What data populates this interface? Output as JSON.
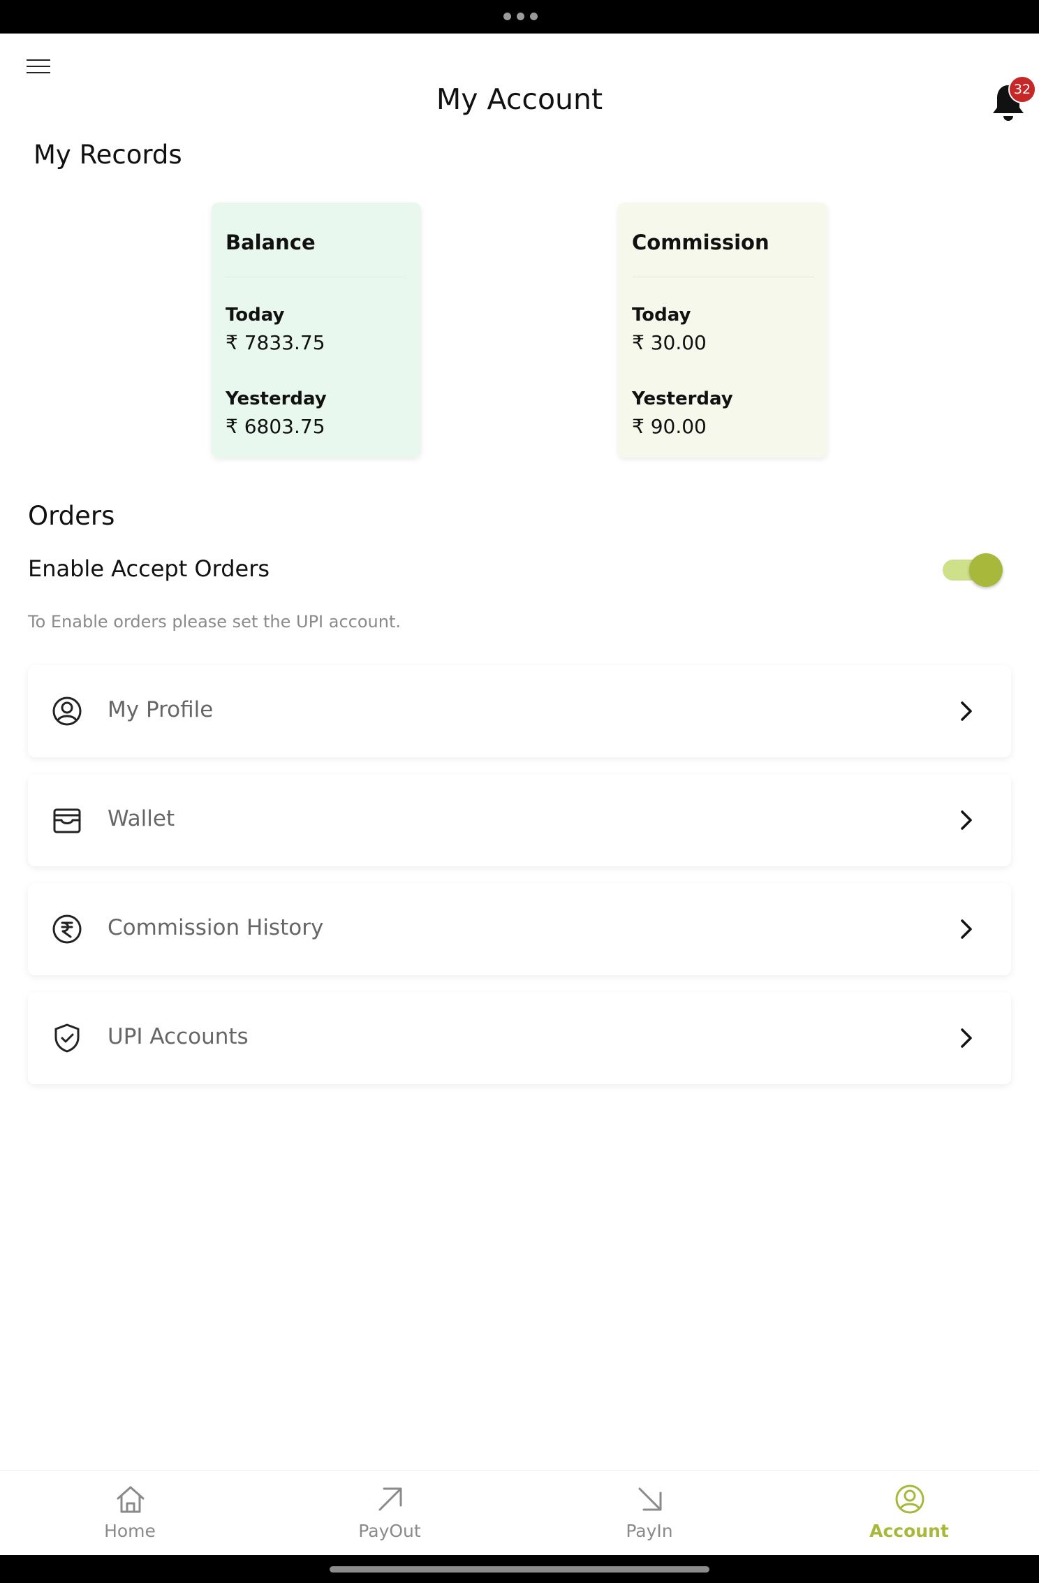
{
  "header": {
    "title": "My Account",
    "notification_count": "32"
  },
  "records": {
    "title": "My Records",
    "balance": {
      "title": "Balance",
      "today_label": "Today",
      "today_value": "₹ 7833.75",
      "yesterday_label": "Yesterday",
      "yesterday_value": "₹ 6803.75"
    },
    "commission": {
      "title": "Commission",
      "today_label": "Today",
      "today_value": "₹ 30.00",
      "yesterday_label": "Yesterday",
      "yesterday_value": "₹ 90.00"
    }
  },
  "orders": {
    "title": "Orders",
    "toggle_label": "Enable Accept Orders",
    "toggle_on": true,
    "hint": "To Enable orders please set the UPI account."
  },
  "menu": {
    "items": [
      {
        "label": "My Profile",
        "icon": "user-circle-icon"
      },
      {
        "label": "Wallet",
        "icon": "wallet-icon"
      },
      {
        "label": "Commission History",
        "icon": "rupee-circle-icon"
      },
      {
        "label": "UPI Accounts",
        "icon": "shield-check-icon"
      }
    ]
  },
  "nav": {
    "items": [
      {
        "label": "Home",
        "icon": "home-icon"
      },
      {
        "label": "PayOut",
        "icon": "arrow-up-right-icon"
      },
      {
        "label": "PayIn",
        "icon": "arrow-down-right-icon"
      },
      {
        "label": "Account",
        "icon": "user-circle-icon",
        "active": true
      }
    ]
  },
  "colors": {
    "accent": "#a8b83a",
    "badge": "#c62828",
    "balance_card": "#e9f8ef",
    "commission_card": "#f6f8ec"
  }
}
